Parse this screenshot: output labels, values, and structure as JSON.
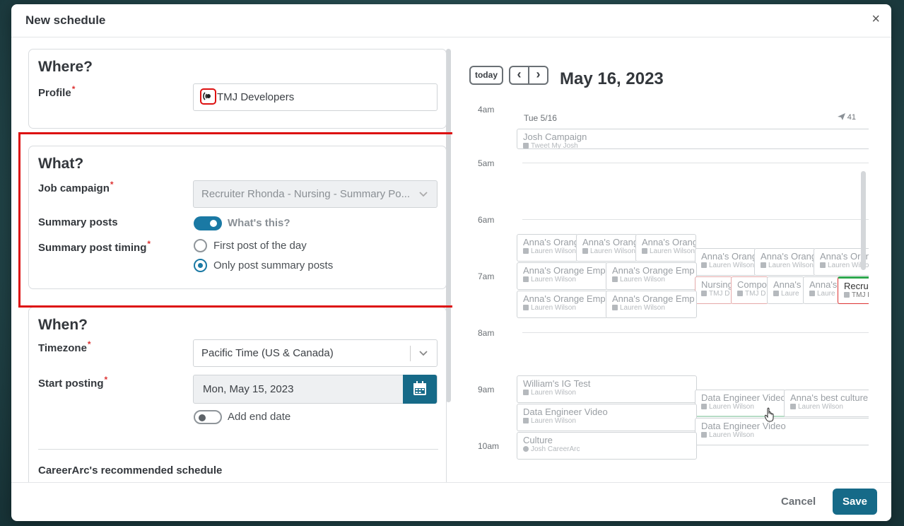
{
  "modal": {
    "title": "New schedule",
    "close_glyph": "×"
  },
  "where": {
    "title": "Where?",
    "profile_label": "Profile",
    "profile_value": "TMJ Developers",
    "profile_icon": "broadcast-icon"
  },
  "what": {
    "title": "What?",
    "job_campaign_label": "Job campaign",
    "job_campaign_value": "Recruiter Rhonda - Nursing - Summary Po...",
    "summary_posts_label": "Summary posts",
    "summary_posts_enabled": true,
    "whats_this": "What's this?",
    "timing_label": "Summary post timing",
    "timing_options": [
      "First post of the day",
      "Only post summary posts"
    ],
    "timing_selected": "Only post summary posts"
  },
  "when": {
    "title": "When?",
    "timezone_label": "Timezone",
    "timezone_value": "Pacific Time (US & Canada)",
    "start_label": "Start posting",
    "start_value": "Mon, May 15, 2023",
    "end_date_label": "Add end date",
    "end_date_enabled": false,
    "recommended_label": "CareerArc's recommended schedule"
  },
  "calendar": {
    "today_label": "today",
    "prev_glyph": "‹",
    "next_glyph": "›",
    "date_title": "May 16, 2023",
    "column_header": "Tue 5/16",
    "post_count": "41",
    "hours": [
      "4am",
      "5am",
      "6am",
      "7am",
      "8am",
      "9am",
      "10am"
    ],
    "events": [
      {
        "title": "Josh Campaign",
        "sub": "Tweet My Josh"
      },
      {
        "title": "Anna's Orange",
        "sub": "Lauren Wilson"
      },
      {
        "title": "Anna's Orang",
        "sub": "Lauren Wilson"
      },
      {
        "title": "Anna's Orang",
        "sub": "Lauren Wilson"
      },
      {
        "title": "Anna's Orang",
        "sub": "Lauren Wilson"
      },
      {
        "title": "Anna's Orang",
        "sub": "Lauren Wilson"
      },
      {
        "title": "Anna's Orang",
        "sub": "Lauren Wilso"
      },
      {
        "title": "Anna's Orange Emp",
        "sub": "Lauren Wilson"
      },
      {
        "title": "Anna's Orange Emp",
        "sub": "Lauren Wilson"
      },
      {
        "title": "Nursing",
        "sub": "TMJ D"
      },
      {
        "title": "Compo",
        "sub": "TMJ D"
      },
      {
        "title": "Anna's",
        "sub": "Laure"
      },
      {
        "title": "Anna's",
        "sub": "Laure"
      },
      {
        "title": "Recruite",
        "sub": "TMJ D"
      },
      {
        "title": "Anna's Orange Empl",
        "sub": "Lauren Wilson"
      },
      {
        "title": "Anna's Orange Emp",
        "sub": "Lauren Wilson"
      },
      {
        "title": "William's IG Test",
        "sub": "Lauren Wilson"
      },
      {
        "title": "Data Engineer Video",
        "sub": "Lauren Wilson"
      },
      {
        "title": "Anna's best culture",
        "sub": "Lauren Wilson"
      },
      {
        "title": "Data Engineer Video",
        "sub": "Lauren Wilson"
      },
      {
        "title": "Data Engineer Video",
        "sub": "Lauren Wilson"
      },
      {
        "title": "Culture",
        "sub": "Josh CareerArc"
      }
    ]
  },
  "footer": {
    "cancel_label": "Cancel",
    "save_label": "Save"
  },
  "colors": {
    "primary": "#166a88",
    "toggle": "#1a79a4",
    "highlight": "#dd1111",
    "required": "#dd3333"
  }
}
